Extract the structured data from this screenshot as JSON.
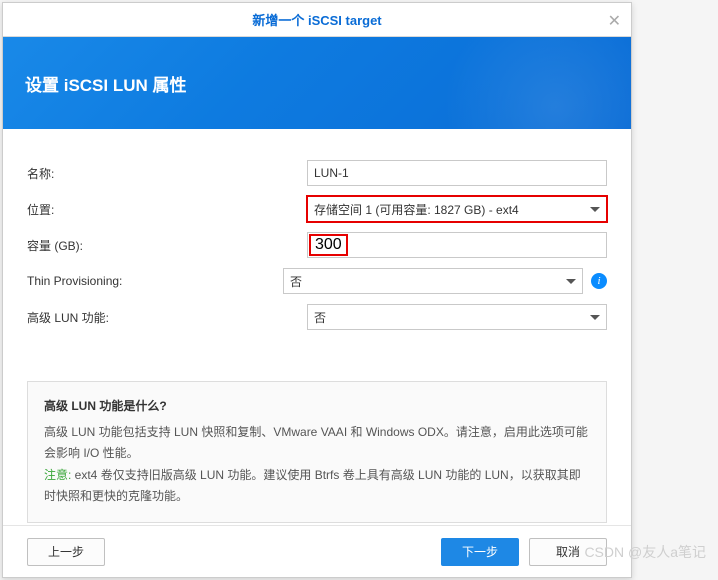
{
  "dialog": {
    "title": "新增一个 iSCSI target",
    "bannerTitle": "设置 iSCSI LUN 属性"
  },
  "form": {
    "nameLabel": "名称:",
    "nameValue": "LUN-1",
    "locationLabel": "位置:",
    "locationValue": "存储空间 1 (可用容量: 1827 GB) - ext4",
    "capacityLabel": "容量 (GB):",
    "capacityValue": "300",
    "thinLabel": "Thin Provisioning:",
    "thinValue": "否",
    "advLabel": "高级 LUN 功能:",
    "advValue": "否"
  },
  "infoBox": {
    "question": "高级 LUN 功能是什么?",
    "body": "高级 LUN 功能包括支持 LUN 快照和复制、VMware VAAI 和 Windows ODX。请注意，启用此选项可能会影响 I/O 性能。",
    "noteLabel": "注意:",
    "noteBody": " ext4 卷仅支持旧版高级 LUN 功能。建议使用 Btrfs 卷上具有高级 LUN 功能的 LUN，以获取其即时快照和更快的克隆功能。"
  },
  "footer": {
    "back": "上一步",
    "next": "下一步",
    "cancel": "取消"
  },
  "watermark": "CSDN @友人a笔记"
}
